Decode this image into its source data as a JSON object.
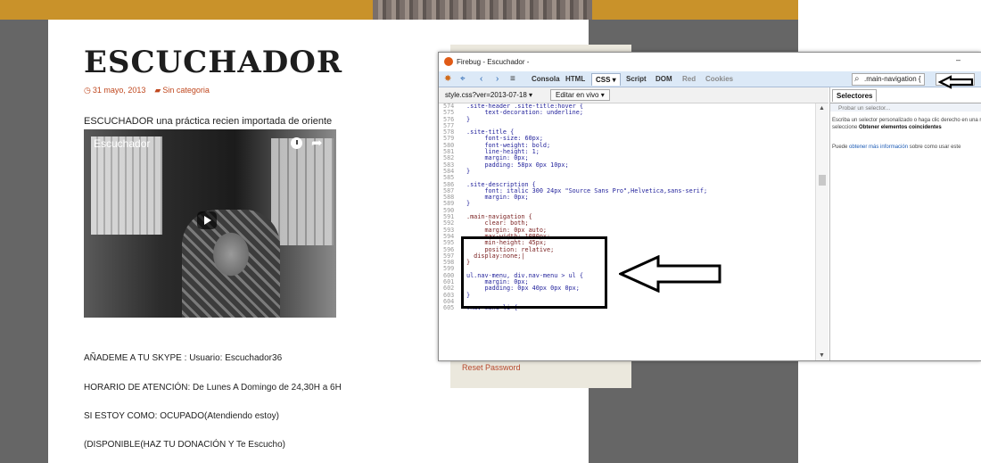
{
  "site": {
    "title": "ESCUCHADOR",
    "meta": {
      "date": "31 mayo, 2013",
      "category": "Sin categoria"
    },
    "intro": "ESCUCHADOR una práctica recien importada de oriente",
    "video_title": "Escuchador",
    "lines": [
      "AÑADEME A TU SKYPE : Usuario: Escuchador36",
      "HORARIO DE ATENCIÓN: De Lunes A Domingo de 24,30H a 6H",
      "SI ESTOY COMO: OCUPADO(Atendiendo estoy)",
      "(DISPONIBLE(HAZ TU DONACIÓN Y Te Escucho)"
    ],
    "reset_password": "Reset Password"
  },
  "firebug": {
    "window_title": "Firebug - Escuchador -",
    "minimize": "–",
    "tabs": {
      "consola": "Consola",
      "html": "HTML",
      "css": "CSS ▾",
      "script": "Script",
      "dom": "DOM",
      "red": "Red",
      "cookies": "Cookies"
    },
    "search_value": ".main-navigation {",
    "file": "style.css?ver=2013-07-18 ▾",
    "edit_button": "Editar en vivo ▾",
    "side": {
      "tab": "Selectores",
      "probe_placeholder": "Probar un selector...",
      "help_pre": "Escriba un selector personalizado o haga clic derecho en una regla CSS y seleccione ",
      "help_bold": "Obtener elementos coincidentes",
      "more_pre": "Puede ",
      "more_link": "obtener más información",
      "more_post": " sobre como usar este"
    },
    "code": [
      {
        "n": "574",
        "t": ".site-header .site-title:hover {"
      },
      {
        "n": "575",
        "t": "     text-decoration: underline;"
      },
      {
        "n": "576",
        "t": "}"
      },
      {
        "n": "577",
        "t": ""
      },
      {
        "n": "578",
        "t": ".site-title {"
      },
      {
        "n": "579",
        "t": "     font-size: 60px;"
      },
      {
        "n": "580",
        "t": "     font-weight: bold;"
      },
      {
        "n": "581",
        "t": "     line-height: 1;"
      },
      {
        "n": "582",
        "t": "     margin: 0px;"
      },
      {
        "n": "583",
        "t": "     padding: 58px 0px 10px;"
      },
      {
        "n": "584",
        "t": "}"
      },
      {
        "n": "585",
        "t": ""
      },
      {
        "n": "586",
        "t": ".site-description {"
      },
      {
        "n": "587",
        "t": "     font: italic 300 24px \"Source Sans Pro\",Helvetica,sans-serif;"
      },
      {
        "n": "588",
        "t": "     margin: 0px;"
      },
      {
        "n": "589",
        "t": "}"
      },
      {
        "n": "590",
        "t": ""
      },
      {
        "n": "591",
        "t": ".main-navigation {"
      },
      {
        "n": "592",
        "t": "     clear: both;"
      },
      {
        "n": "593",
        "t": "     margin: 0px auto;"
      },
      {
        "n": "594",
        "t": "     max-width: 1080px;"
      },
      {
        "n": "595",
        "t": "     min-height: 45px;"
      },
      {
        "n": "596",
        "t": "     position: relative;"
      },
      {
        "n": "597",
        "t": "  display:none;|"
      },
      {
        "n": "598",
        "t": "}"
      },
      {
        "n": "599",
        "t": ""
      },
      {
        "n": "600",
        "t": "ul.nav-menu, div.nav-menu > ul {"
      },
      {
        "n": "601",
        "t": "     margin: 0px;"
      },
      {
        "n": "602",
        "t": "     padding: 0px 40px 0px 0px;"
      },
      {
        "n": "603",
        "t": "}"
      },
      {
        "n": "604",
        "t": ""
      },
      {
        "n": "605",
        "t": ".nav-menu li {"
      }
    ]
  },
  "colors": {
    "header": "#c9922a",
    "accent": "#c0481f",
    "bg": "#666666",
    "toolbar": "#dce9f7"
  },
  "icons": [
    "firebug-icon",
    "inspect-icon",
    "back-icon",
    "forward-icon",
    "command-line-icon",
    "clock-icon",
    "share-icon",
    "play-icon",
    "search-icon",
    "arrow-icon"
  ]
}
